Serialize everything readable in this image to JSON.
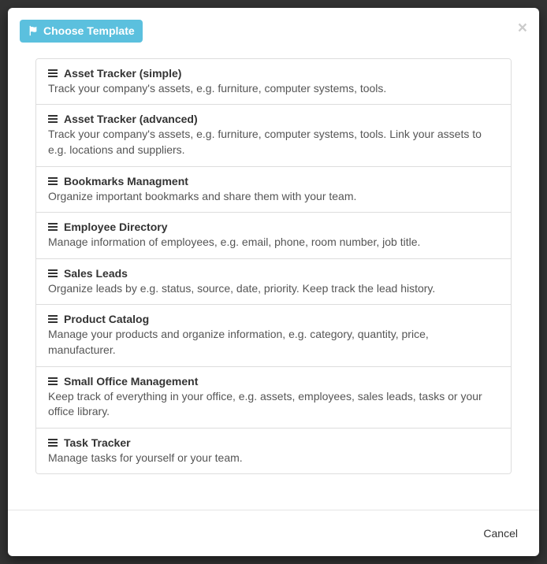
{
  "header": {
    "title": "Choose Template"
  },
  "templates": [
    {
      "title": "Asset Tracker (simple)",
      "desc": "Track your company's assets, e.g. furniture, computer systems, tools."
    },
    {
      "title": "Asset Tracker (advanced)",
      "desc": "Track your company's assets, e.g. furniture, computer systems, tools. Link your assets to e.g. locations and suppliers."
    },
    {
      "title": "Bookmarks Managment",
      "desc": "Organize important bookmarks and share them with your team."
    },
    {
      "title": "Employee Directory",
      "desc": "Manage information of employees, e.g. email, phone, room number, job title."
    },
    {
      "title": "Sales Leads",
      "desc": "Organize leads by e.g. status, source, date, priority. Keep track the lead history."
    },
    {
      "title": "Product Catalog",
      "desc": "Manage your products and organize information, e.g. category, quantity, price, manufacturer."
    },
    {
      "title": "Small Office Management",
      "desc": "Keep track of everything in your office, e.g. assets, employees, sales leads, tasks or your office library."
    },
    {
      "title": "Task Tracker",
      "desc": "Manage tasks for yourself or your team."
    }
  ],
  "footer": {
    "cancel": "Cancel"
  }
}
